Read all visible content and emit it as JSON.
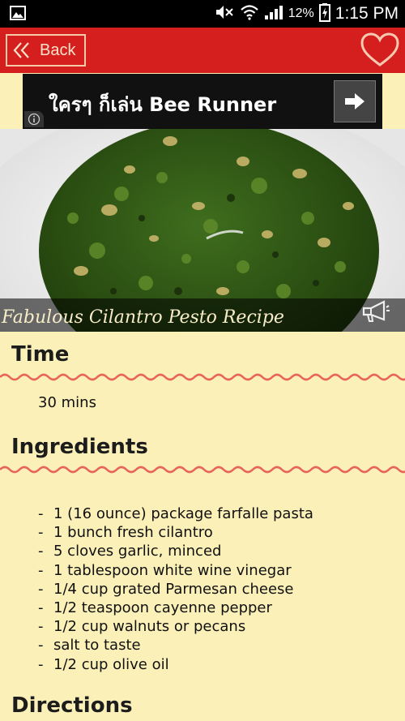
{
  "status_bar": {
    "battery_percent": "12%",
    "time": "1:15 PM",
    "icons": [
      "gallery-icon",
      "mute-icon",
      "wifi-icon",
      "signal-icon",
      "battery-icon"
    ]
  },
  "action_bar": {
    "back_label": "Back",
    "favorite_icon": "heart-icon",
    "color": "#d51f1f"
  },
  "ad": {
    "text": "ใครๆ ก็เล่น Bee Runner",
    "arrow_icon": "arrow-right-icon",
    "info_icon": "info-icon"
  },
  "hero": {
    "title": "Fabulous Cilantro Pesto Recipe",
    "speaker_icon": "megaphone-icon"
  },
  "sections": {
    "time_title": "Time",
    "time_value": "30 mins",
    "ingredients_title": "Ingredients",
    "directions_title": "Directions"
  },
  "ingredients": [
    "1 (16 ounce) package farfalle pasta",
    "1 bunch fresh cilantro",
    "5 cloves garlic, minced",
    "1 tablespoon white wine vinegar",
    "1/4 cup grated Parmesan cheese",
    "1/2 teaspoon cayenne pepper",
    "1/2 cup walnuts or pecans",
    "salt to taste",
    "1/2 cup olive oil"
  ],
  "colors": {
    "background": "#fbf0b8",
    "accent": "#d51f1f",
    "wave": "#e8645a"
  }
}
